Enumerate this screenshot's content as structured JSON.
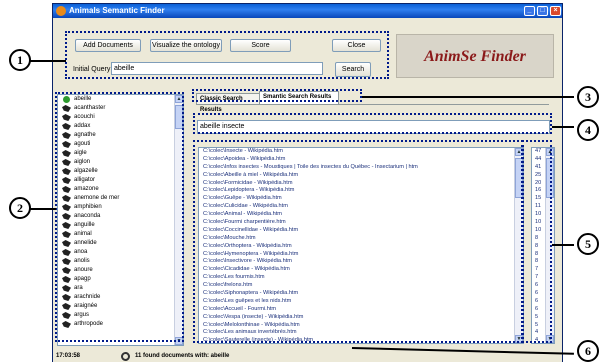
{
  "window": {
    "title": "Animals Semantic Finder"
  },
  "toolbar": {
    "add_documents": "Add Documents",
    "visualize": "Visualize the ontology",
    "score": "Score",
    "close": "Close",
    "initial_query_label": "Initial Query",
    "initial_query_value": "abeille",
    "search": "Search"
  },
  "logo": "AnimSe Finder",
  "animals": [
    "abeille",
    "acanthaster",
    "acouchi",
    "addax",
    "agnathe",
    "agouti",
    "aigle",
    "aiglon",
    "algazelle",
    "alligator",
    "amazone",
    "anemone de mer",
    "amphibien",
    "anaconda",
    "anguille",
    "animal",
    "annelide",
    "anoa",
    "anolis",
    "anoure",
    "apagp",
    "ara",
    "arachnide",
    "araignée",
    "argus",
    "arthropode"
  ],
  "tabs": {
    "classic": "Classic Search Results",
    "semantic": "Smantic Search Results"
  },
  "expanded_query": "abeille insecte",
  "results": [
    "C:\\colec\\Insecte - Wikipédia.htm",
    "C:\\colec\\Apoidea - Wikipédia.htm",
    "C:\\colec\\Infos insectes - Moustiques | Toile des insectes du Québec - Insectarium | htm",
    "C:\\colec\\Abeille à miel - Wikipédia.htm",
    "C:\\colec\\Formicidae - Wikipédia.htm",
    "C:\\colec\\Lepidoptera - Wikipédia.htm",
    "C:\\colec\\Guêpe - Wikipédia.htm",
    "C:\\colec\\Culicidae - Wikipédia.htm",
    "C:\\colec\\Animal - Wikipédia.htm",
    "C:\\colec\\Fourmi charpentière.htm",
    "C:\\colec\\Coccinellidae - Wikipédia.htm",
    "C:\\colec\\Mouche.htm",
    "C:\\colec\\Orthoptera - Wikipédia.htm",
    "C:\\colec\\Hymenoptera - Wikipédia.htm",
    "C:\\colec\\Insectivore - Wikipédia.htm",
    "C:\\colec\\Cicadidae - Wikipédia.htm",
    "C:\\colec\\Les fourmis.htm",
    "C:\\colec\\frelons.htm",
    "C:\\colec\\Siphonaptera - Wikipédia.htm",
    "C:\\colec\\Les guêpes et les nids.htm",
    "C:\\colec\\Accueil - Fourmi.htm",
    "C:\\colec\\Vespa (insecte) - Wikipédia.htm",
    "C:\\colec\\Melolonthinae - Wikipédia.htm",
    "C:\\colec\\Les animaux invertébrés.htm",
    "C:\\colec\\Sauterelle (insecte) - Wikipédia.htm"
  ],
  "scores": [
    "47",
    "44",
    "41",
    "25",
    "20",
    "16",
    "15",
    "11",
    "10",
    "10",
    "10",
    "8",
    "8",
    "8",
    "8",
    "7",
    "7",
    "6",
    "6",
    "6",
    "6",
    "5",
    "5",
    "4",
    "4"
  ],
  "status": {
    "time": "17:03:58",
    "message": "11 found documents with: abeille"
  },
  "callouts": [
    "1",
    "2",
    "3",
    "4",
    "5",
    "6"
  ]
}
